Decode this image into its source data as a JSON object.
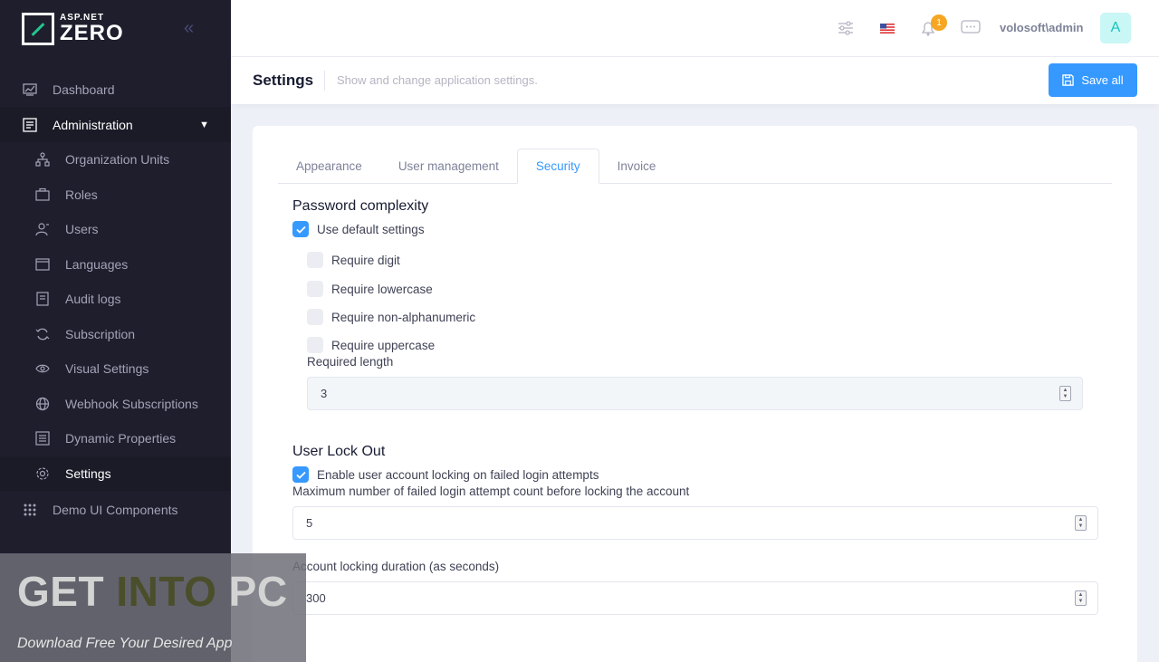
{
  "brand": {
    "small": "ASP.NET",
    "big": "ZERO"
  },
  "sidebar": {
    "items": [
      {
        "label": "Dashboard"
      },
      {
        "label": "Administration"
      },
      {
        "label": "Organization Units"
      },
      {
        "label": "Roles"
      },
      {
        "label": "Users"
      },
      {
        "label": "Languages"
      },
      {
        "label": "Audit logs"
      },
      {
        "label": "Subscription"
      },
      {
        "label": "Visual Settings"
      },
      {
        "label": "Webhook Subscriptions"
      },
      {
        "label": "Dynamic Properties"
      },
      {
        "label": "Settings"
      },
      {
        "label": "Demo UI Components"
      }
    ]
  },
  "header": {
    "notification_count": "1",
    "username": "volosoft\\admin",
    "avatar_letter": "A"
  },
  "subheader": {
    "title": "Settings",
    "description": "Show and change application settings.",
    "save_label": "Save all"
  },
  "tabs": [
    {
      "label": "Appearance"
    },
    {
      "label": "User management"
    },
    {
      "label": "Security"
    },
    {
      "label": "Invoice"
    }
  ],
  "password": {
    "title": "Password complexity",
    "use_default": "Use default settings",
    "require_digit": "Require digit",
    "require_lowercase": "Require lowercase",
    "require_nonalpha": "Require non-alphanumeric",
    "require_uppercase": "Require uppercase",
    "required_length_label": "Required length",
    "required_length_value": "3"
  },
  "lockout": {
    "title": "User Lock Out",
    "enable_label": "Enable user account locking on failed login attempts",
    "max_attempts_label": "Maximum number of failed login attempt count before locking the account",
    "max_attempts_value": "5",
    "duration_label": "Account locking duration (as seconds)",
    "duration_value": "300"
  },
  "watermark": {
    "title_get": "GET ",
    "title_into": "INTO",
    "title_pc": " PC",
    "subtitle": "Download Free Your Desired App"
  },
  "colors": {
    "primary": "#3699ff",
    "sidebar": "#1e1e2d",
    "badge": "#f5a623"
  }
}
